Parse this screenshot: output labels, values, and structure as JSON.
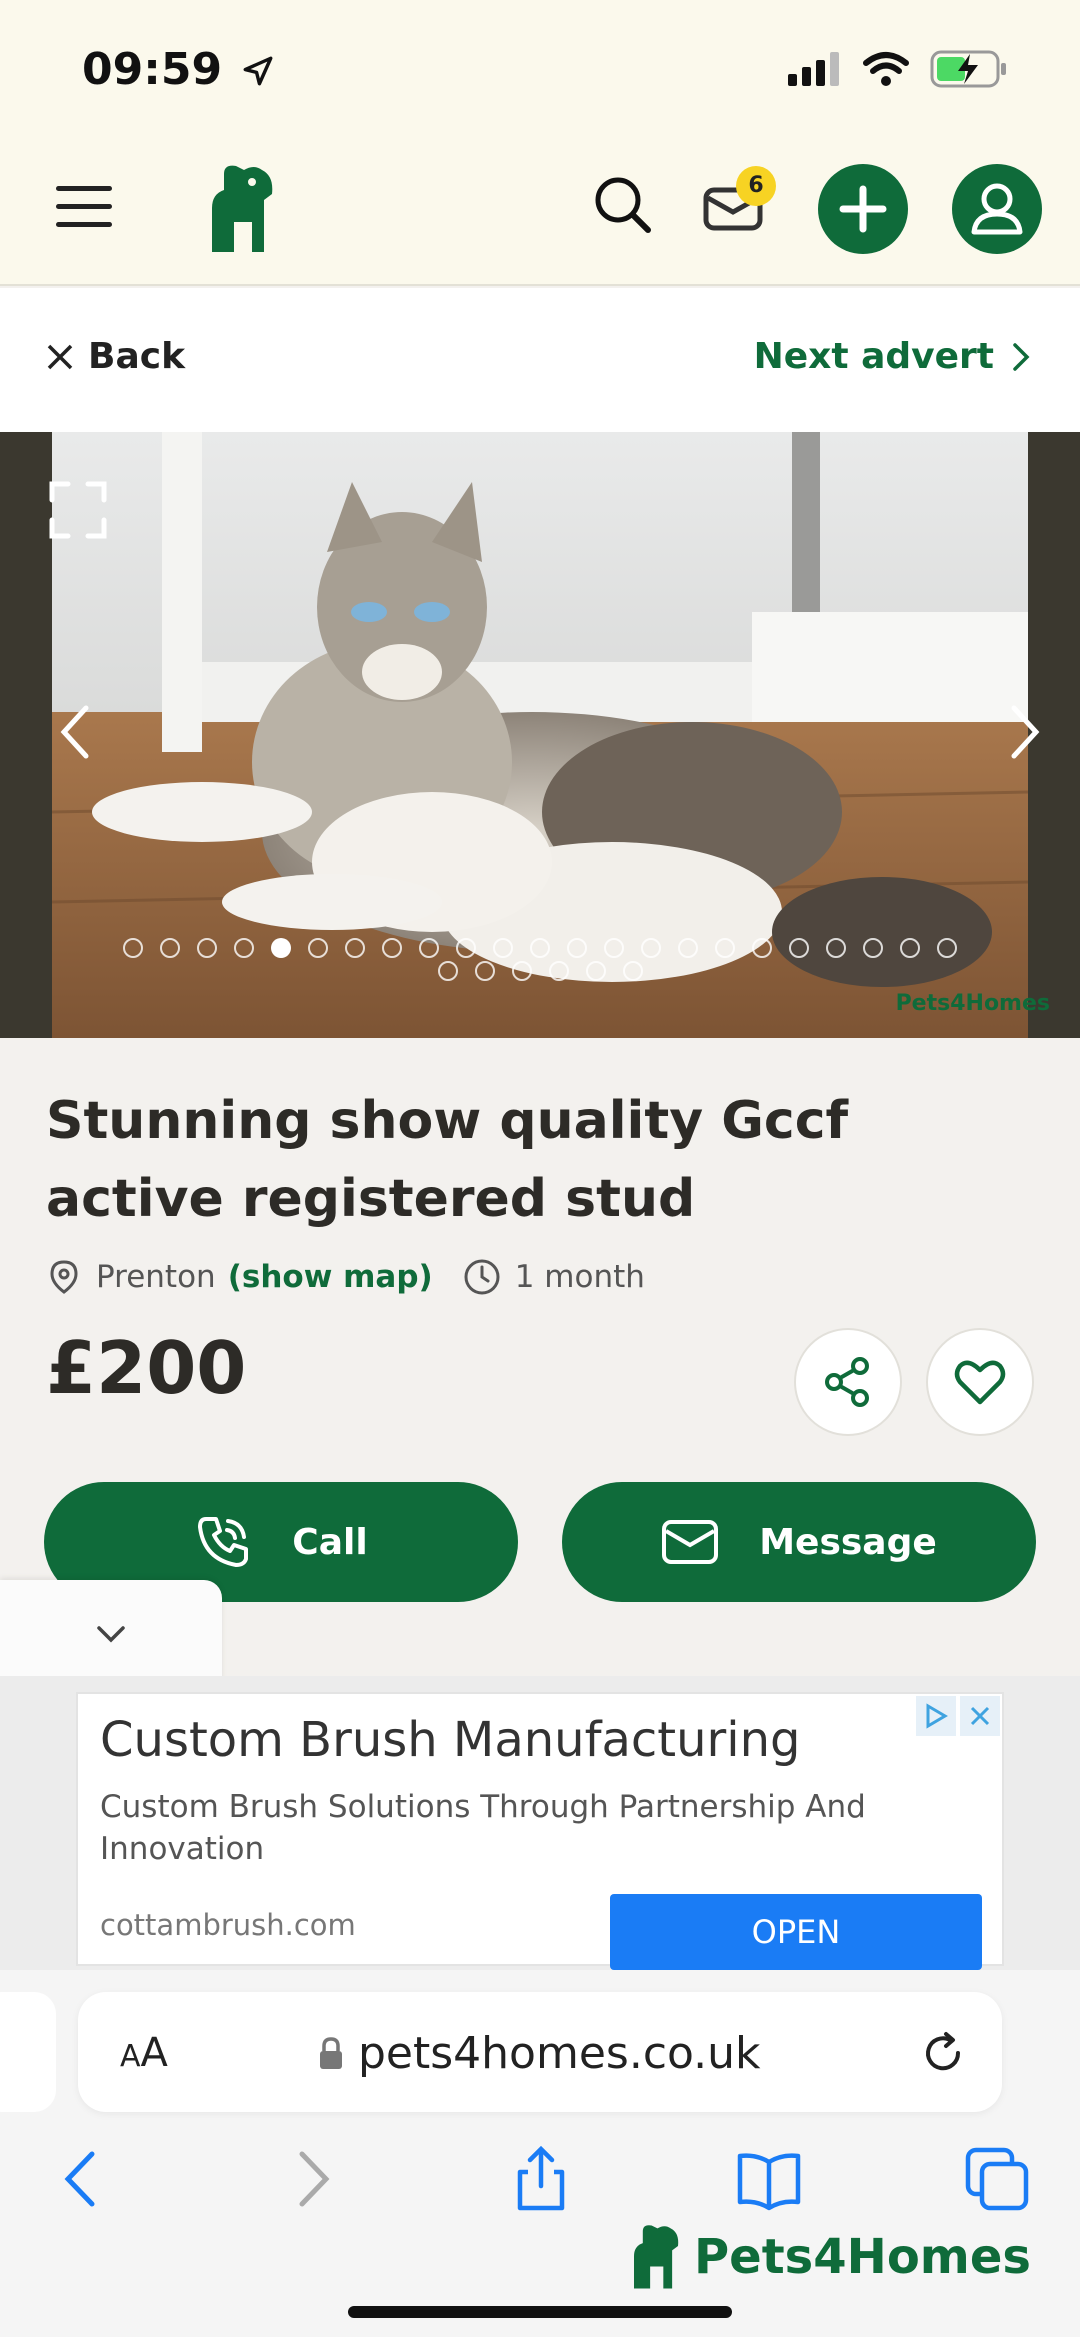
{
  "status": {
    "time": "09:59"
  },
  "nav": {
    "mail_badge": "6"
  },
  "backbar": {
    "back_label": "Back",
    "next_label": "Next advert"
  },
  "gallery": {
    "watermark": "Pets4Homes",
    "total_images": 29,
    "active_index": 4
  },
  "listing": {
    "title": "Stunning show quality Gccf active registered stud",
    "location": "Prenton",
    "map_link": "(show map)",
    "age": "1 month",
    "price": "£200"
  },
  "actions": {
    "call_label": "Call",
    "message_label": "Message"
  },
  "ad": {
    "title": "Custom Brush Manufacturing",
    "description": "Custom Brush Solutions Through Partnership And Innovation",
    "domain": "cottambrush.com",
    "open_label": "OPEN"
  },
  "browser": {
    "aa_label": "AA",
    "url": "pets4homes.co.uk"
  },
  "footer": {
    "brand": "Pets4Homes"
  },
  "colors": {
    "brand_green": "#0f6b3a",
    "badge_yellow": "#f7d323",
    "ad_blue": "#1a7cf5"
  }
}
